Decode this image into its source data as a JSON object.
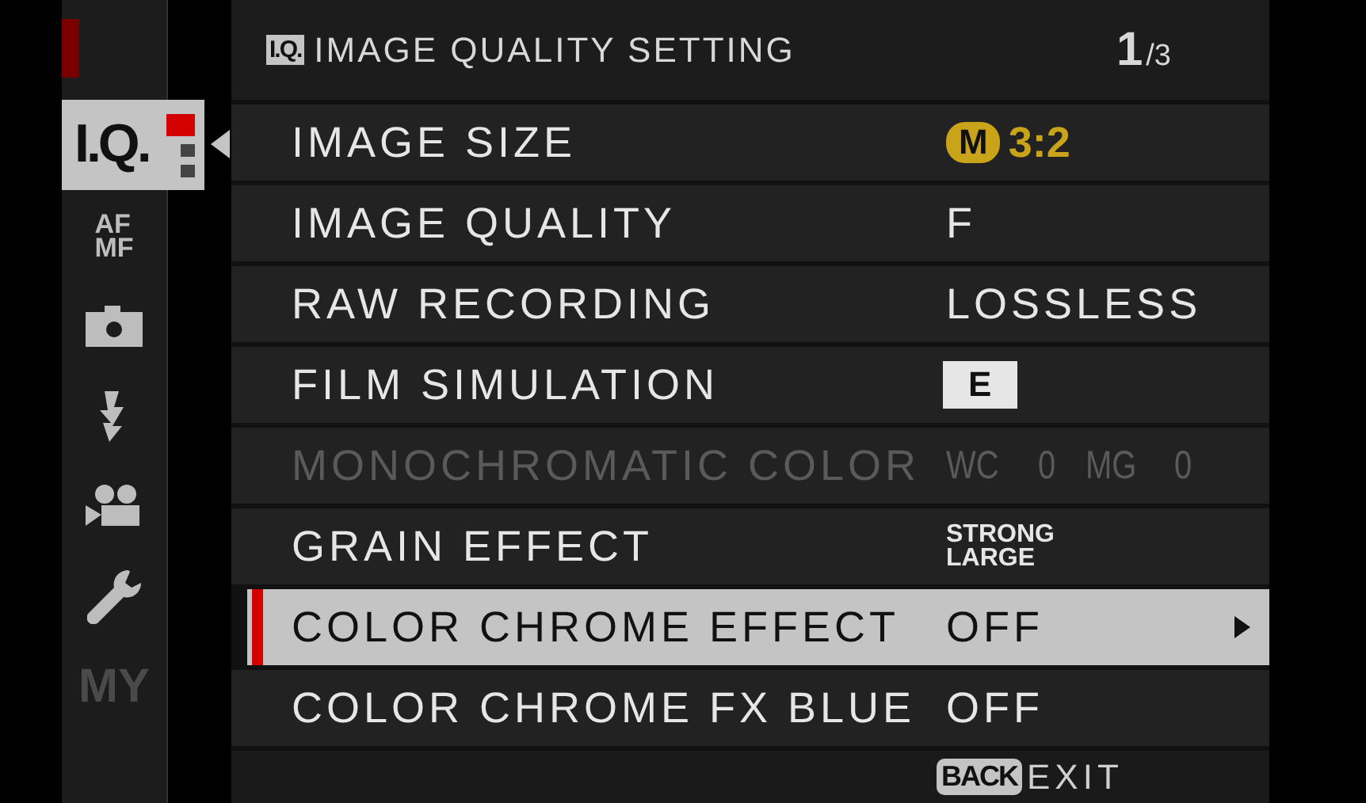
{
  "sidebar": {
    "items": [
      {
        "kind": "iq",
        "label": "I.Q.",
        "selected": true
      },
      {
        "kind": "afmf",
        "lines": [
          "AF",
          "MF"
        ],
        "selected": false
      },
      {
        "kind": "camera",
        "selected": false
      },
      {
        "kind": "flash",
        "selected": false
      },
      {
        "kind": "movie",
        "selected": false
      },
      {
        "kind": "wrench",
        "selected": false
      },
      {
        "kind": "my",
        "label": "MY",
        "selected": false,
        "disabled": true
      }
    ],
    "pages": [
      {
        "selected": true
      },
      {
        "selected": false
      },
      {
        "selected": false
      }
    ]
  },
  "header": {
    "badge": "I.Q.",
    "title": "IMAGE QUALITY SETTING",
    "page": "1",
    "page_total": "/3"
  },
  "rows": [
    {
      "label": "IMAGE SIZE",
      "selected": false,
      "disabled": false,
      "value": {
        "kind": "size",
        "badge": "M",
        "text": "3:2"
      }
    },
    {
      "label": "IMAGE QUALITY",
      "selected": false,
      "disabled": false,
      "value": {
        "kind": "text",
        "text": "F"
      }
    },
    {
      "label": "RAW RECORDING",
      "selected": false,
      "disabled": false,
      "value": {
        "kind": "text",
        "text": "LOSSLESS"
      }
    },
    {
      "label": "FILM SIMULATION",
      "selected": false,
      "disabled": false,
      "value": {
        "kind": "film",
        "text": "E"
      }
    },
    {
      "label": "MONOCHROMATIC COLOR",
      "selected": false,
      "disabled": true,
      "value": {
        "kind": "pairs",
        "parts": [
          "WC",
          "0",
          "MG",
          "0"
        ]
      }
    },
    {
      "label": "GRAIN EFFECT",
      "selected": false,
      "disabled": false,
      "value": {
        "kind": "stacked",
        "lines": [
          "STRONG",
          "LARGE"
        ]
      }
    },
    {
      "label": "COLOR CHROME EFFECT",
      "selected": true,
      "disabled": false,
      "value": {
        "kind": "text",
        "text": "OFF"
      }
    },
    {
      "label": "COLOR CHROME FX BLUE",
      "selected": false,
      "disabled": false,
      "value": {
        "kind": "text",
        "text": "OFF"
      }
    }
  ],
  "footer": {
    "key": "BACK",
    "action": "EXIT"
  }
}
